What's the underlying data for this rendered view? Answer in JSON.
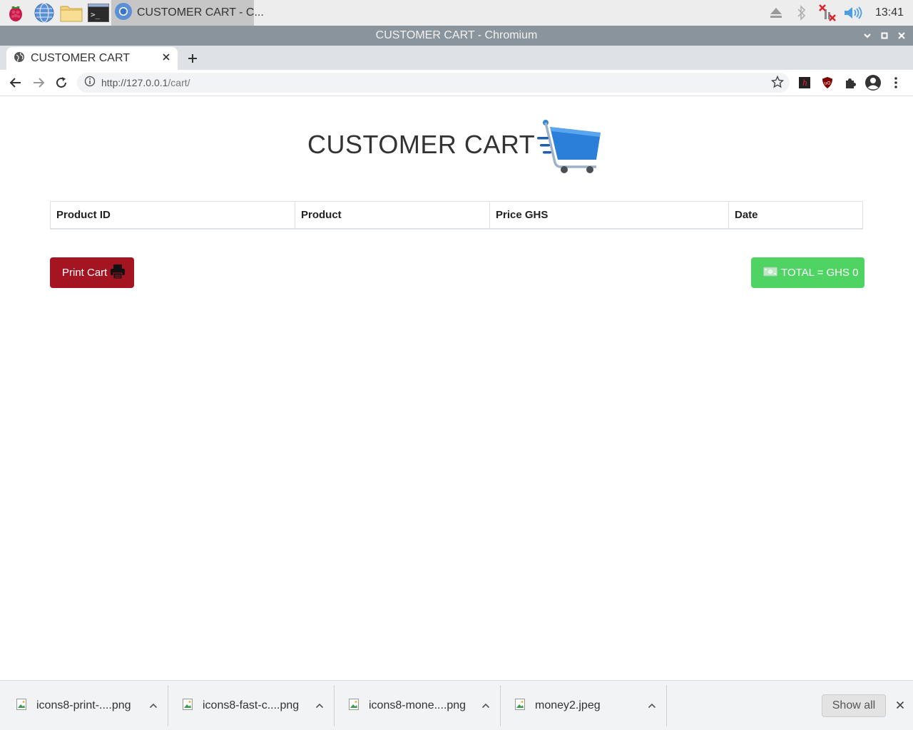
{
  "taskbar": {
    "app_title": "CUSTOMER CART - C...",
    "clock": "13:41"
  },
  "window": {
    "title": "CUSTOMER CART - Chromium"
  },
  "tab": {
    "title": "CUSTOMER CART"
  },
  "toolbar": {
    "url_host": "http://127.0.0.1",
    "url_path": "/cart/"
  },
  "page": {
    "heading": "CUSTOMER CART",
    "table": {
      "columns": [
        "Product ID",
        "Product",
        "Price GHS",
        "Date"
      ],
      "rows": []
    },
    "print_button": "Print Cart",
    "total_button": "TOTAL = GHS 0"
  },
  "downloads": {
    "items": [
      {
        "name": "icons8-print-....png"
      },
      {
        "name": "icons8-fast-c....png"
      },
      {
        "name": "icons8-mone....png"
      },
      {
        "name": "money2.jpeg"
      }
    ],
    "show_all": "Show all"
  },
  "colors": {
    "print_button": "#a51521",
    "total_button": "#4fd464",
    "title_bar": "#8a949c"
  }
}
